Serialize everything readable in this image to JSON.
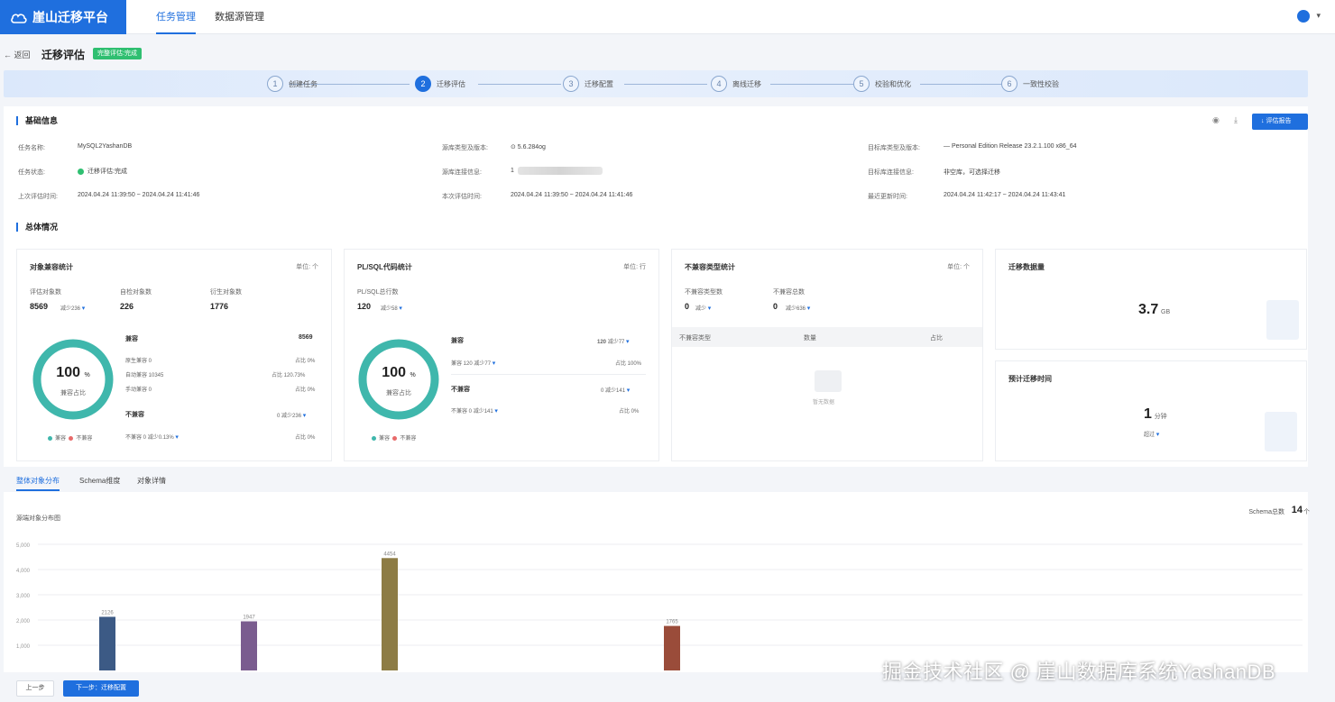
{
  "app": {
    "name": "崖山迁移平台",
    "nav": [
      "任务管理",
      "数据源管理"
    ]
  },
  "header": {
    "back": "← 返回",
    "title": "迁移评估",
    "status": "完整评估:完成"
  },
  "steps": [
    {
      "num": "1",
      "label": "创建任务"
    },
    {
      "num": "2",
      "label": "迁移评估",
      "active": true
    },
    {
      "num": "3",
      "label": "迁移配置"
    },
    {
      "num": "4",
      "label": "离线迁移"
    },
    {
      "num": "5",
      "label": "校验和优化"
    },
    {
      "num": "6",
      "label": "一致性校验"
    }
  ],
  "basic": {
    "title": "基础信息",
    "report_btn": "↓ 评估报告",
    "fields": [
      {
        "label": "任务名称:",
        "value": "MySQL2YashanDB"
      },
      {
        "label": "源库类型及版本:",
        "value": "⊙ 5.6.284og"
      },
      {
        "label": "目标库类型及版本:",
        "value": "— Personal Edition Release 23.2.1.100 x86_64"
      },
      {
        "label": "任务状态:",
        "value": "迁移评估:完成"
      },
      {
        "label": "源库连接信息:",
        "value": "1"
      },
      {
        "label": "目标库连接信息:",
        "value": "非空库，可选择迁移"
      },
      {
        "label": "上次评估时间:",
        "value": "2024.04.24 11:39:50 ~ 2024.04.24 11:41:46"
      },
      {
        "label": "本次评估时间:",
        "value": "2024.04.24 11:39:50 ~ 2024.04.24 11:41:46"
      },
      {
        "label": "最近更新时间:",
        "value": "2024.04.24 11:42:17 ~ 2024.04.24 11:43:41"
      }
    ]
  },
  "overview": {
    "title": "总体情况"
  },
  "obj_card": {
    "title": "对象兼容统计",
    "unit": "单位: 个",
    "metrics": [
      {
        "label": "评估对象数",
        "value": "8569",
        "sub": "减少236"
      },
      {
        "label": "自检对象数",
        "value": "226"
      },
      {
        "label": "衍生对象数",
        "value": "1776"
      }
    ],
    "ring_value": "100",
    "ring_unit": "%",
    "ring_label": "兼容占比",
    "compat_label": "兼容",
    "compat_value": "8569",
    "rows": [
      {
        "left": "原生兼容 0",
        "right": "占比 0%"
      },
      {
        "left": "自动兼容 10345",
        "right": "占比 120.73%"
      },
      {
        "left": "手动兼容 0",
        "right": "占比 0%"
      }
    ],
    "incompat_label": "不兼容",
    "incompat_value": "0",
    "incompat_sub": "减少236",
    "bottom": {
      "left": "不兼容 0",
      "sub": "减少0.13%",
      "right": "占比 0%"
    },
    "legend": [
      "兼容",
      "不兼容"
    ]
  },
  "pl_card": {
    "title": "PL/SQL代码统计",
    "unit": "单位: 行",
    "metric_label": "PL/SQL总行数",
    "metric_value": "120",
    "metric_sub": "减少58",
    "ring_value": "100",
    "ring_unit": "%",
    "ring_label": "兼容占比",
    "compat_label": "兼容",
    "compat_value": "120",
    "compat_sub": "减少77",
    "compat_row": {
      "left": "兼容 120",
      "sub": "减少77",
      "right": "占比 100%"
    },
    "incompat_label": "不兼容",
    "incompat_value": "0",
    "incompat_sub": "减少141",
    "incompat_row": {
      "left": "不兼容 0",
      "sub": "减少141",
      "right": "占比 0%"
    },
    "legend": [
      "兼容",
      "不兼容"
    ]
  },
  "incompat_card": {
    "title": "不兼容类型统计",
    "unit": "单位: 个",
    "metrics": [
      {
        "label": "不兼容类型数",
        "value": "0",
        "sub": "减少"
      },
      {
        "label": "不兼容总数",
        "value": "0",
        "sub": "减少636"
      }
    ],
    "columns": [
      "不兼容类型",
      "数量",
      "占比"
    ],
    "empty": "暂无数据"
  },
  "size_card": {
    "title": "迁移数据量",
    "value": "3.7",
    "unit": "GB"
  },
  "time_card": {
    "title": "预计迁移时间",
    "value": "1",
    "unit": "分钟",
    "sub": "超过"
  },
  "tabs": [
    "整体对象分布",
    "Schema维度",
    "对象详情"
  ],
  "chart": {
    "title": "源端对象分布图",
    "schema_label": "Schema总数",
    "schema_value": "14",
    "schema_unit": "个"
  },
  "chart_data": {
    "type": "bar",
    "ylim": [
      0,
      5000
    ],
    "yticks": [
      "5,000",
      "4,000",
      "3,000",
      "2,000",
      "1,000"
    ],
    "labels": [
      "2126",
      "1947",
      "4454",
      "1765"
    ],
    "values": [
      2126,
      1947,
      4454,
      1765
    ],
    "colors": [
      "#3c5a85",
      "#7a5c8f",
      "#8d7c45",
      "#9a4c3a"
    ]
  },
  "footer": {
    "prev": "上一步",
    "next": "下一步：迁移配置"
  },
  "watermark": "掘金技术社区 @ 崖山数据库系统YashanDB"
}
